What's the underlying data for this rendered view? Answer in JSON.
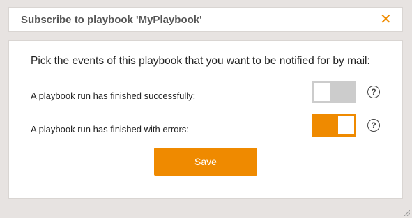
{
  "dialog": {
    "title": "Subscribe to playbook 'MyPlaybook'",
    "close_glyph": "✕",
    "prompt": "Pick the events of this playbook that you want to be notified for by mail:",
    "events": [
      {
        "label": "A playbook run has finished successfully:",
        "enabled": false,
        "help_glyph": "?"
      },
      {
        "label": "A playbook run has finished with errors:",
        "enabled": true,
        "help_glyph": "?"
      }
    ],
    "save_label": "Save"
  },
  "colors": {
    "accent": "#ef8a00",
    "toggle_off": "#cccccc",
    "background": "#e7e3e1"
  },
  "icons": {
    "close": "close-icon",
    "help": "help-circle-icon",
    "resize": "resize-grip-icon"
  }
}
